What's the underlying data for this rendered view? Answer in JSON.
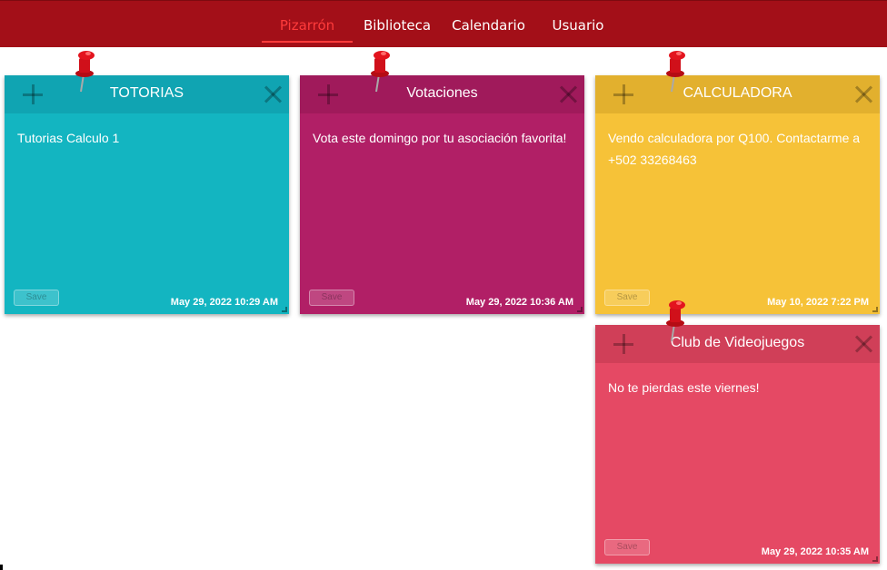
{
  "nav": {
    "items": [
      {
        "label": "Pizarrón",
        "active": true
      },
      {
        "label": "Biblioteca",
        "active": false
      },
      {
        "label": "Calendario",
        "active": false
      },
      {
        "label": "Usuario",
        "active": false
      }
    ]
  },
  "notes": [
    {
      "title": "TOTORIAS",
      "body": "Tutorias Calculo 1",
      "date": "May 29, 2022 10:29 AM",
      "save_label": "Save",
      "color": "#13b5c1",
      "header_color": "#10a4b2"
    },
    {
      "title": "Votaciones",
      "body": "Vota este domingo por tu asociación favorita!",
      "date": "May 29, 2022 10:36 AM",
      "save_label": "Save",
      "color": "#b11f66",
      "header_color": "#a01a5b"
    },
    {
      "title": "CALCULADORA",
      "body": "Vendo calculadora por Q100. Contactarme a +502 33268463",
      "date": "May 10, 2022 7:22 PM",
      "save_label": "Save",
      "color": "#f6c238",
      "header_color": "#e2b02e"
    },
    {
      "title": "Club de Videojuegos",
      "body": "No te pierdas este viernes!",
      "date": "May 29, 2022 10:35 AM",
      "save_label": "Save",
      "color": "#e54964",
      "header_color": "#d03f58"
    }
  ],
  "icons": {
    "add": "plus-icon",
    "close": "close-icon",
    "pin": "pushpin-icon",
    "resize": "resize-handle-icon"
  },
  "colors": {
    "navbar": "#a30f18",
    "nav_active": "#ff3b3b",
    "pin": "#d0101a"
  }
}
